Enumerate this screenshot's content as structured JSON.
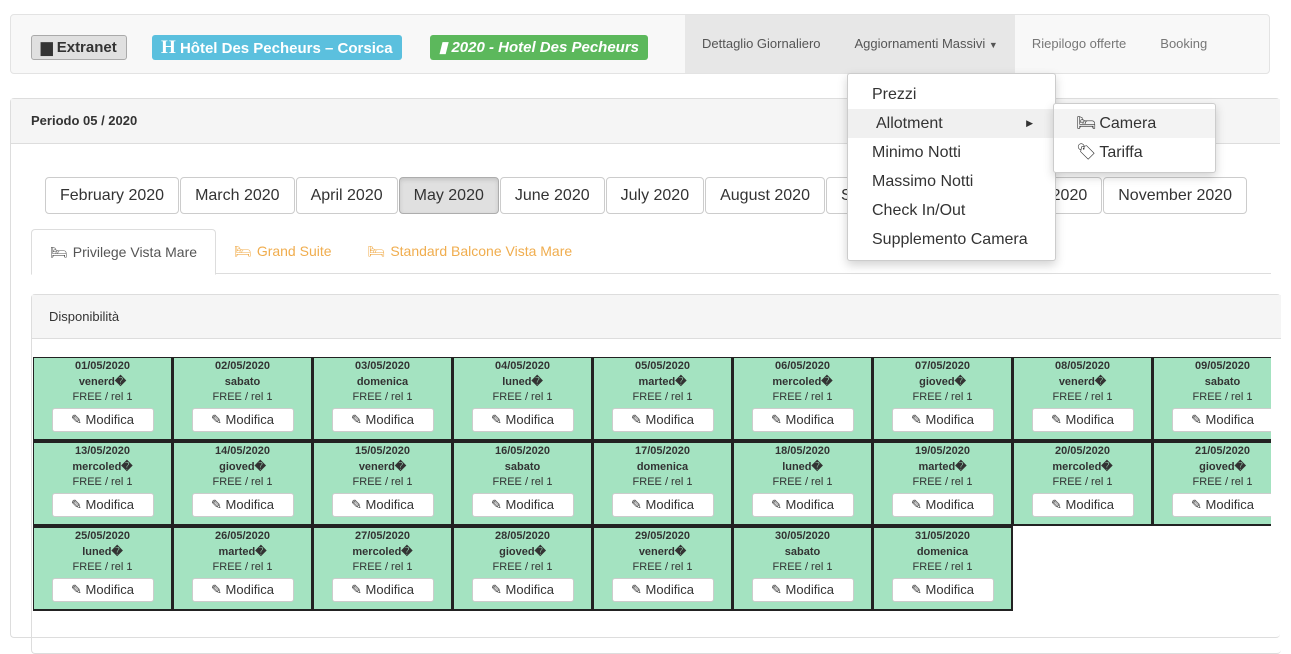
{
  "header": {
    "extranet": "Extranet",
    "hotel": "Hôtel Des Pecheurs – Corsica",
    "hotel_icon": "H",
    "year": "2020 - Hotel Des Pecheurs",
    "nav": [
      "Dettaglio Giornaliero",
      "Aggiornamenti Massivi",
      "Riepilogo offerte",
      "Booking"
    ]
  },
  "colors": {
    "info": "#5bc0de",
    "success": "#5cb85c",
    "cell": "#a4e3c1",
    "warning": "#f0ad4e"
  },
  "period": "Periodo 05 / 2020",
  "months": [
    "February 2020",
    "March 2020",
    "April 2020",
    "May 2020",
    "June 2020",
    "July 2020",
    "August 2020",
    "September 2020",
    "October 2020",
    "November 2020"
  ],
  "selected_month": "May 2020",
  "rooms": [
    "Privilege Vista Mare",
    "Grand Suite",
    "Standard Balcone Vista Mare"
  ],
  "availability_title": "Disponibilità",
  "edit_label": "Modifica",
  "status": "FREE / rel 1",
  "rows": [
    [
      [
        "01/05/2020",
        "venerd�"
      ],
      [
        "02/05/2020",
        "sabato"
      ],
      [
        "03/05/2020",
        "domenica"
      ],
      [
        "04/05/2020",
        "luned�"
      ],
      [
        "05/05/2020",
        "marted�"
      ],
      [
        "06/05/2020",
        "mercoled�"
      ],
      [
        "07/05/2020",
        "gioved�"
      ],
      [
        "08/05/2020",
        "venerd�"
      ],
      [
        "09/05/2020",
        "sabato"
      ]
    ],
    [
      [
        "13/05/2020",
        "mercoled�"
      ],
      [
        "14/05/2020",
        "gioved�"
      ],
      [
        "15/05/2020",
        "venerd�"
      ],
      [
        "16/05/2020",
        "sabato"
      ],
      [
        "17/05/2020",
        "domenica"
      ],
      [
        "18/05/2020",
        "luned�"
      ],
      [
        "19/05/2020",
        "marted�"
      ],
      [
        "20/05/2020",
        "mercoled�"
      ],
      [
        "21/05/2020",
        "gioved�"
      ]
    ],
    [
      [
        "25/05/2020",
        "luned�"
      ],
      [
        "26/05/2020",
        "marted�"
      ],
      [
        "27/05/2020",
        "mercoled�"
      ],
      [
        "28/05/2020",
        "gioved�"
      ],
      [
        "29/05/2020",
        "venerd�"
      ],
      [
        "30/05/2020",
        "sabato"
      ],
      [
        "31/05/2020",
        "domenica"
      ]
    ]
  ],
  "menu": {
    "items": [
      "Prezzi",
      "Allotment",
      "Minimo Notti",
      "Massimo Notti",
      "Check In/Out",
      "Supplemento Camera"
    ],
    "submenu": [
      "Camera",
      "Tariffa"
    ]
  }
}
